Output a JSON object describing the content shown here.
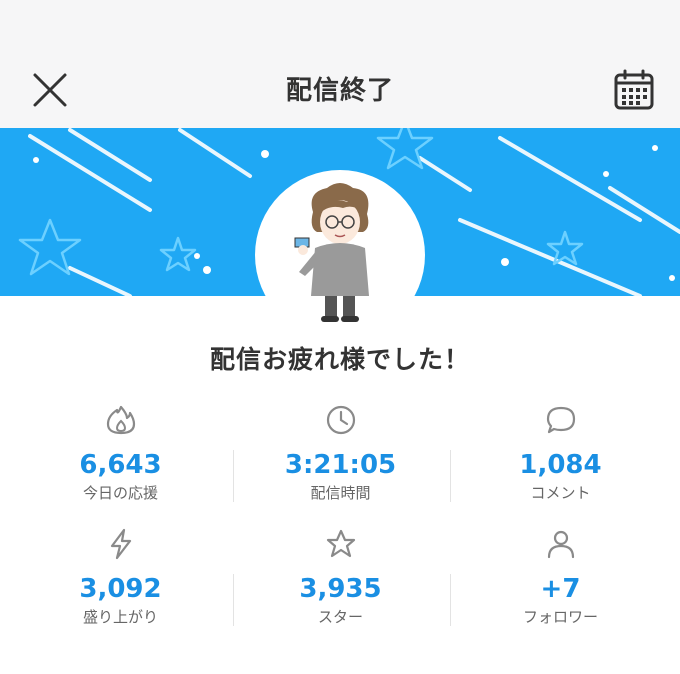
{
  "header": {
    "title": "配信終了",
    "close_icon": "close-icon",
    "calendar_icon": "calendar-icon"
  },
  "banner": {
    "color": "#1fa8f4",
    "avatar": "streamer-avatar"
  },
  "message": "配信お疲れ様でした！",
  "stats": [
    {
      "icon": "flame-icon",
      "value": "6,643",
      "label": "今日の応援"
    },
    {
      "icon": "clock-icon",
      "value": "3:21:05",
      "label": "配信時間"
    },
    {
      "icon": "speech-bubble-icon",
      "value": "1,084",
      "label": "コメント"
    },
    {
      "icon": "lightning-icon",
      "value": "3,092",
      "label": "盛り上がり"
    },
    {
      "icon": "star-icon",
      "value": "3,935",
      "label": "スター"
    },
    {
      "icon": "person-icon",
      "value": "+7",
      "label": "フォロワー"
    }
  ],
  "colors": {
    "accent": "#1a8fe3",
    "icon": "#8a8a8a",
    "text": "#333333"
  }
}
